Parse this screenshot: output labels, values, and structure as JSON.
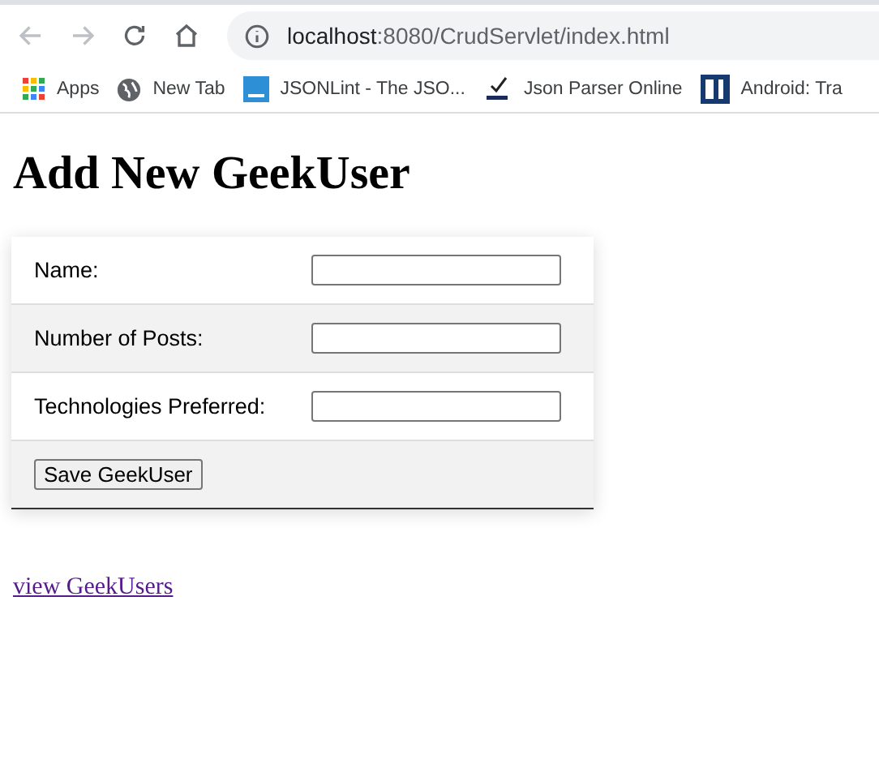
{
  "browser": {
    "url_host": "localhost",
    "url_rest": ":8080/CrudServlet/index.html"
  },
  "bookmarks": [
    {
      "label": "Apps",
      "kind": "apps"
    },
    {
      "label": "New Tab",
      "kind": "globe"
    },
    {
      "label": "JSONLint - The JSO...",
      "kind": "jsonlint"
    },
    {
      "label": "Json Parser Online",
      "kind": "json"
    },
    {
      "label": "Android: Tra",
      "kind": "android"
    }
  ],
  "heading": "Add New GeekUser",
  "form": {
    "fields": [
      {
        "label": "Name:"
      },
      {
        "label": "Number of Posts:"
      },
      {
        "label": "Technologies Preferred:"
      }
    ],
    "submit": "Save GeekUser"
  },
  "link": "view GeekUsers"
}
